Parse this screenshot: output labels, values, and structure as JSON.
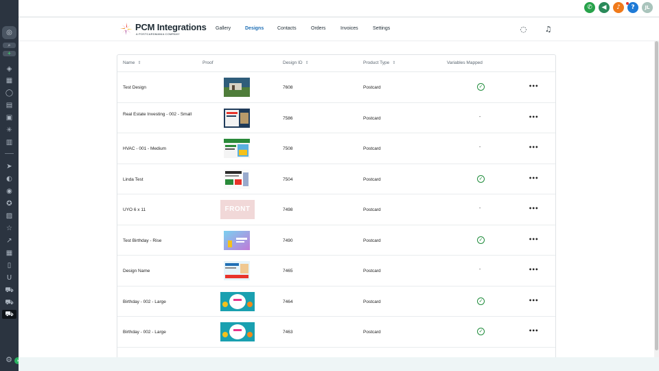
{
  "brand": {
    "name": "PCM Integrations",
    "tagline": "A POSTCARDMANIA COMPANY"
  },
  "nav": {
    "items": [
      "Gallery",
      "Designs",
      "Contacts",
      "Orders",
      "Invoices",
      "Settings"
    ],
    "active": "Designs"
  },
  "topbar": {
    "user_initials": "JL",
    "help_glyph": "?"
  },
  "table": {
    "columns": {
      "name": "Name",
      "proof": "Proof",
      "design_id": "Design ID",
      "product_type": "Product Type",
      "variables_mapped": "Variables Mapped"
    },
    "rows": [
      {
        "name": "Test Design",
        "design_id": "7608",
        "product_type": "Postcard",
        "variables_mapped": true
      },
      {
        "name": "Real Estate Investing - 002 - Small",
        "design_id": "7586",
        "product_type": "Postcard",
        "variables_mapped": false
      },
      {
        "name": "HVAC - 001 - Medium",
        "design_id": "7508",
        "product_type": "Postcard",
        "variables_mapped": false
      },
      {
        "name": "Linda Test",
        "design_id": "7504",
        "product_type": "Postcard",
        "variables_mapped": true
      },
      {
        "name": "UYO 6 x 11",
        "design_id": "7498",
        "product_type": "Postcard",
        "variables_mapped": false
      },
      {
        "name": "Test Birthday - Rise",
        "design_id": "7490",
        "product_type": "Postcard",
        "variables_mapped": true
      },
      {
        "name": "Design Name",
        "design_id": "7465",
        "product_type": "Postcard",
        "variables_mapped": false
      },
      {
        "name": "Birthday - 002 - Large",
        "design_id": "7464",
        "product_type": "Postcard",
        "variables_mapped": true
      },
      {
        "name": "Birthday - 002 - Large",
        "design_id": "7463",
        "product_type": "Postcard",
        "variables_mapped": true
      }
    ],
    "unmapped_mark": "-",
    "proof_front_text": "FRONT"
  },
  "colors": {
    "accent": "#1f6fb5",
    "success": "#1e8b3a",
    "sidebar": "#2b3440"
  }
}
